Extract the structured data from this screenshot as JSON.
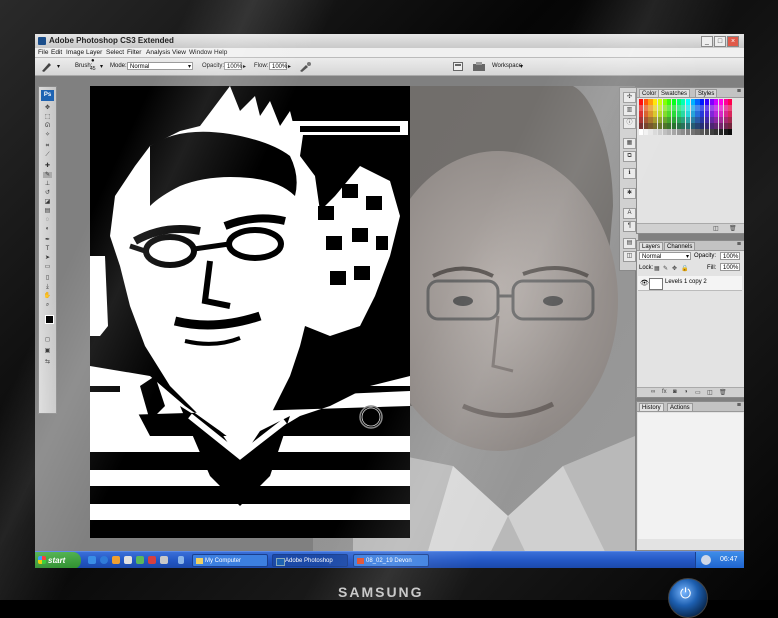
{
  "window": {
    "title": "Adobe Photoshop CS3 Extended"
  },
  "menu": [
    "File",
    "Edit",
    "Image",
    "Layer",
    "Select",
    "Filter",
    "Analysis",
    "View",
    "Window",
    "Help"
  ],
  "options": {
    "brush_label": "Brush:",
    "brush_size": "45",
    "mode_label": "Mode:",
    "mode_value": "Normal",
    "opacity_label": "Opacity:",
    "opacity_value": "100%",
    "flow_label": "Flow:",
    "flow_value": "100%",
    "workspace": "Workspace"
  },
  "toolbox": {
    "logo": "Ps"
  },
  "panels": {
    "color_tabs": [
      "Color",
      "Swatches",
      "Styles"
    ],
    "layers_tabs": [
      "Layers",
      "Channels"
    ],
    "blend_mode": "Normal",
    "opacity_label": "Opacity:",
    "opacity_value": "100%",
    "lock_label": "Lock:",
    "fill_label": "Fill:",
    "fill_value": "100%",
    "layer_name": "Levels 1 copy 2",
    "history_tabs": [
      "History",
      "Actions"
    ]
  },
  "taskbar": {
    "start": "start",
    "tasks": [
      "My Computer",
      "Adobe Photoshop CS3...",
      "08_02_19 Devon Lon..."
    ],
    "clock": "06:47"
  },
  "monitor": {
    "brand": "SAMSUNG"
  },
  "colors": {
    "xp_blue": "#2357c4",
    "start_green": "#3b9f3b",
    "ps_blue": "#1e63b2"
  }
}
